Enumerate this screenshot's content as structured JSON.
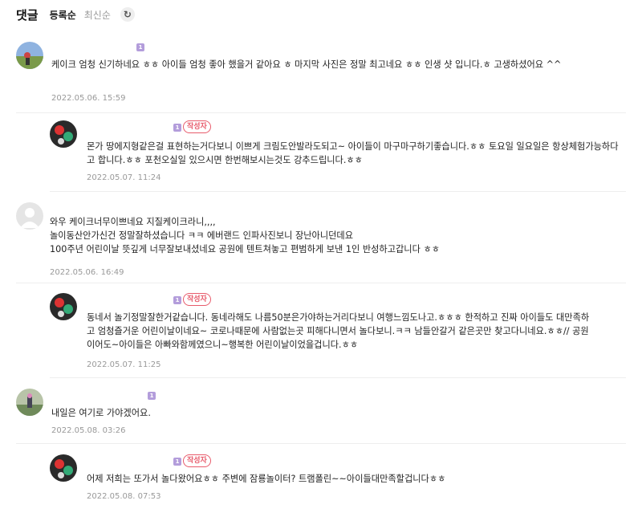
{
  "header": {
    "title": "댓글",
    "sort_registered": "등록순",
    "sort_latest": "최신순",
    "refresh_icon": "refresh-icon"
  },
  "badges": {
    "new": "1",
    "author": "작성자"
  },
  "comments": [
    {
      "text": "케이크 엄청 신기하네요 ㅎㅎ 아이들 엄청 좋아 했을거 같아요 ㅎ 마지막 사진은 정말 최고네요 ㅎㅎ 인생 샷 입니다.ㅎ 고생하셨어요 ^^",
      "date": "2022.05.06. 15:59"
    },
    {
      "text": "몬가 땅에지형같은걸 표현하는거다보니 이쁘게 크림도안발라도되고~ 아이들이 마구마구하기좋습니다.ㅎㅎ 토요일 일요일은 항상체험가능하다고 합니다.ㅎㅎ 포천오실일 있으시면 한번해보시는것도 강추드립니다.ㅎㅎ",
      "date": "2022.05.07. 11:24"
    },
    {
      "lines": [
        "와우 케이크너무이쁘네요 지질케이크라니,,,,",
        "놀이동산안가신건 정말잘하셨습니다 ㅋㅋ 에버랜드 인파사진보니 장난아니던데요",
        "100주년 어린이날 뜻깊게 너무잘보내셨네요 공원에 텐트쳐놓고 편범하게 보낸 1인 반성하고갑니다 ㅎㅎ"
      ],
      "date": "2022.05.06. 16:49"
    },
    {
      "text": "동네서 놀기정말잘한거같습니다. 동네라해도 나름50분은가야하는거리다보니 여행느낌도나고.ㅎㅎㅎ 한적하고 진짜 아이들도 대만족하고 엄청즐거운 어린이날이네요~ 코로나때문에 사람없는곳 피해다니면서 놀다보니.ㅋㅋ 남들안갈거 같은곳만 찾고다니네요.ㅎㅎ// 공원이어도~아이들은 아빠와함께였으니~행복한 어린이날이었을겁니다.ㅎㅎ",
      "date": "2022.05.07. 11:25"
    },
    {
      "text": "내일은 여기로 가야겠어요.",
      "date": "2022.05.08. 03:26"
    },
    {
      "text": "어제 저희는 또가서 놀다왔어요ㅎㅎ 주변에 잠룡놀이터? 트램폴린~~아이들대만족할겁니다ㅎㅎ",
      "date": "2022.05.08. 07:53"
    }
  ]
}
